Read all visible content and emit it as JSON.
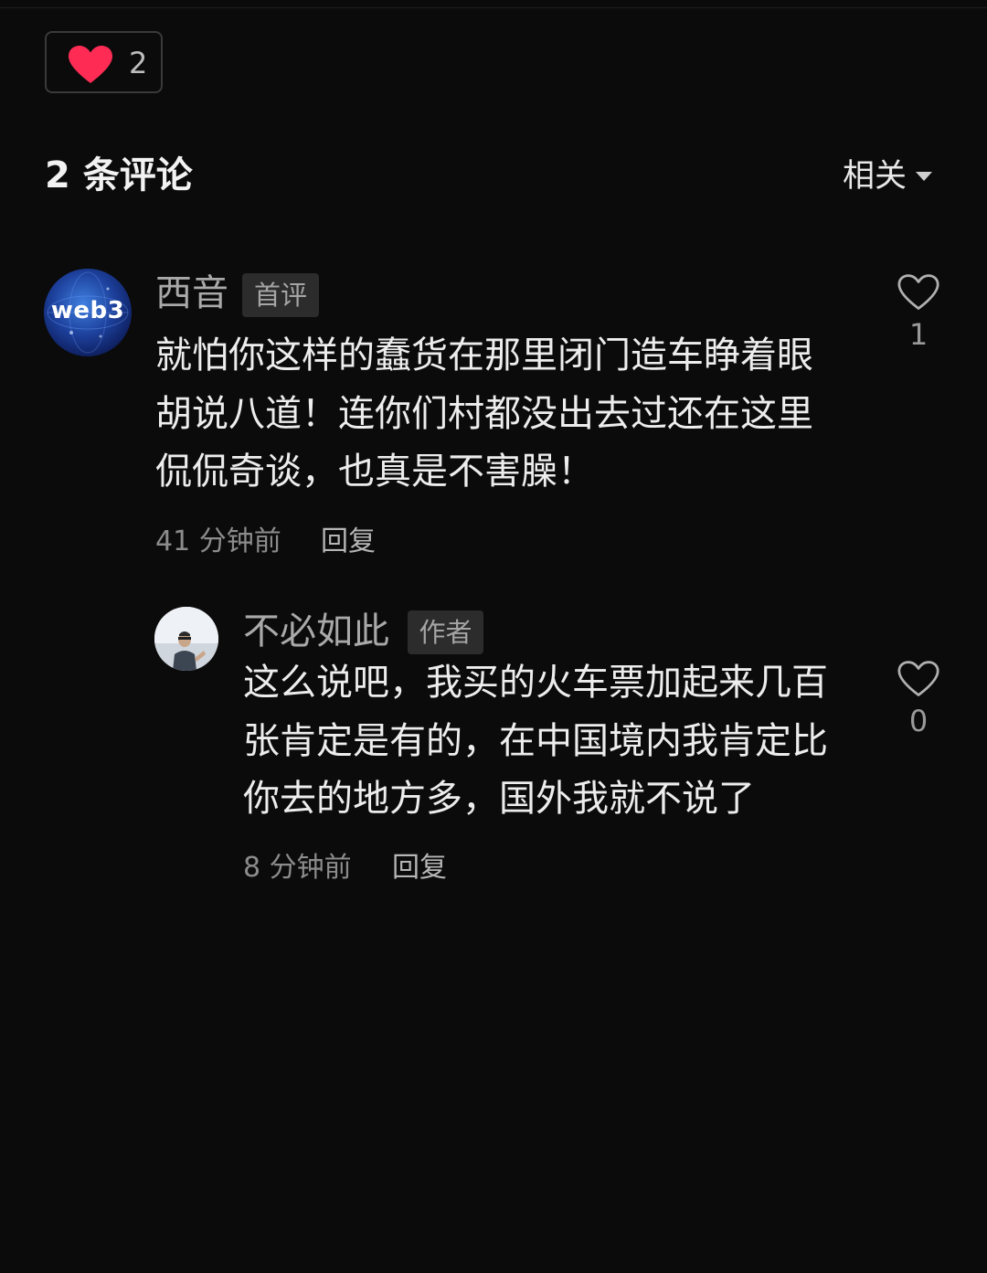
{
  "post": {
    "like_count": "2"
  },
  "comments_header": {
    "title": "2 条评论",
    "sort_label": "相关"
  },
  "comments": [
    {
      "avatar_text": "web3",
      "username": "西音",
      "badge": "首评",
      "lines": [
        "就怕你这样的蠢货在那里闭门造车睁着眼",
        "胡说八道！连你们村都没出去过还在这里",
        "侃侃奇谈，也真是不害臊！"
      ],
      "time": "41 分钟前",
      "reply_label": "回复",
      "like_count": "1"
    },
    {
      "username": "不必如此",
      "badge": "作者",
      "lines": [
        "这么说吧，我买的火车票加起来几百",
        "张肯定是有的，在中国境内我肯定比",
        "你去的地方多，国外我就不说了"
      ],
      "time": "8 分钟前",
      "reply_label": "回复",
      "like_count": "0"
    }
  ],
  "colors": {
    "background": "#0b0b0b",
    "heart_filled": "#fe2c55",
    "text_primary": "#ededed",
    "text_secondary": "#a9a9a9"
  },
  "icons": {
    "post_like": "heart-filled-icon",
    "comment_like": "heart-outline-icon",
    "sort": "caret-down-icon"
  }
}
